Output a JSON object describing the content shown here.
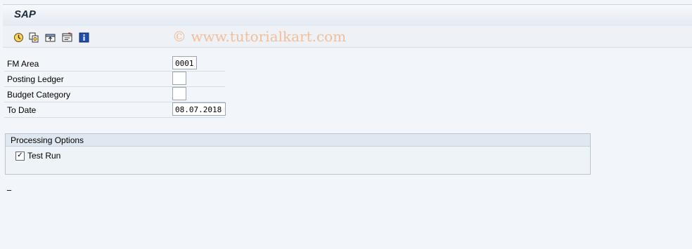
{
  "window": {
    "title": "SAP"
  },
  "toolbar": {
    "buttons": [
      {
        "icon": "execute-icon"
      },
      {
        "icon": "copy-variant-icon"
      },
      {
        "icon": "get-variant-icon"
      },
      {
        "icon": "save-variant-icon"
      },
      {
        "icon": "info-icon"
      }
    ]
  },
  "watermark": "© www.tutorialkart.com",
  "form": {
    "fm_area": {
      "label": "FM Area",
      "value": "0001"
    },
    "posting_ledger": {
      "label": "Posting Ledger",
      "value": ""
    },
    "budget_category": {
      "label": "Budget Category",
      "value": ""
    },
    "to_date": {
      "label": "To Date",
      "value": "08.07.2018"
    }
  },
  "processing_options": {
    "title": "Processing Options",
    "test_run": {
      "label": "Test Run",
      "checked": true,
      "mark": "✓"
    }
  },
  "status": "_",
  "colors": {
    "background": "#f2f5f9",
    "watermark": "#f2b98f",
    "group_border": "#b9c5d2"
  }
}
